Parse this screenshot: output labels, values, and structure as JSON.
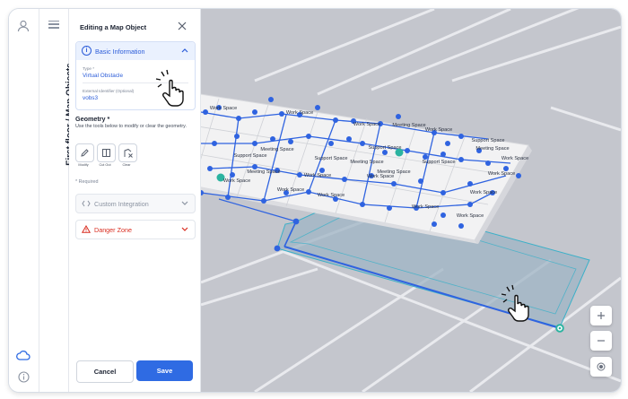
{
  "breadcrumb": "First floor / Map Objects",
  "panel": {
    "title": "Editing a Map Object",
    "basic_info": {
      "label": "Basic Information",
      "type_label": "Type *",
      "type_value": "Virtual Obstacle",
      "ext_id_label": "External Identifier (Optional)",
      "ext_id_value": "vobs3"
    },
    "geometry": {
      "title": "Geometry *",
      "description": "Use the tools below to modify or clear the geometry.",
      "tools": [
        {
          "label": "Modify",
          "icon": "pencil-icon"
        },
        {
          "label": "Cut Out",
          "icon": "cut-out-icon"
        },
        {
          "label": "Clear",
          "icon": "clear-shape-icon"
        }
      ]
    },
    "required_note": "* Required",
    "custom_integration": "Custom Integration",
    "danger_zone": "Danger Zone",
    "cancel": "Cancel",
    "save": "Save"
  },
  "map": {
    "labels": [
      "Work Space",
      "Work Space",
      "Work Space",
      "Meeting Space",
      "Work Space",
      "Meeting Space",
      "Support Space",
      "Support Space",
      "Meeting Space",
      "Support Space",
      "Meeting Space",
      "Support Space",
      "Meeting Space",
      "Work Space",
      "Work Space",
      "Work Space",
      "Work Space",
      "Work Space",
      "Work Space",
      "Work Space",
      "Work Space",
      "Support Space",
      "Meeting Space",
      "Work Space",
      "Work Space"
    ]
  },
  "colors": {
    "accent": "#2f6be3",
    "danger": "#d92d20",
    "map_bg": "#c4c6cd",
    "obstacle_fill": "#9fb4c4",
    "node": "#2f63e0",
    "teal": "#2bb3a0"
  }
}
